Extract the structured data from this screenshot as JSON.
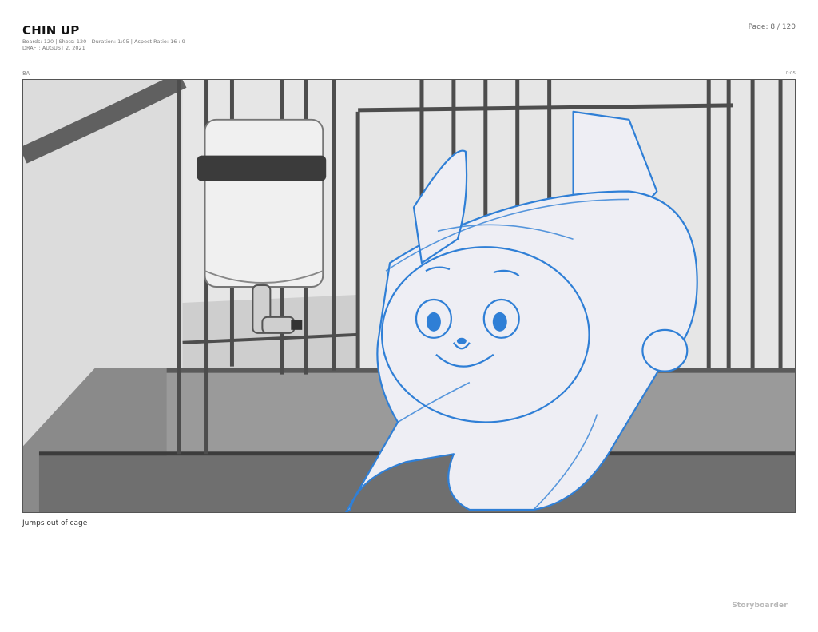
{
  "header": {
    "title": "CHIN UP",
    "meta_line1": "Boards: 120  |  Shots: 120  |  Duration: 1:05  |  Aspect Ratio: 16 : 9",
    "meta_line2": "DRAFT: AUGUST 2, 2021",
    "page": "Page: 8 / 120"
  },
  "board": {
    "shot_label": "8A",
    "duration": "0:05",
    "caption": "Jumps out of cage"
  },
  "footer": {
    "brand": "Storyboarder"
  },
  "colors": {
    "sketch_blue": "#2f7fd6",
    "background_gray": "#e8e8e8"
  }
}
